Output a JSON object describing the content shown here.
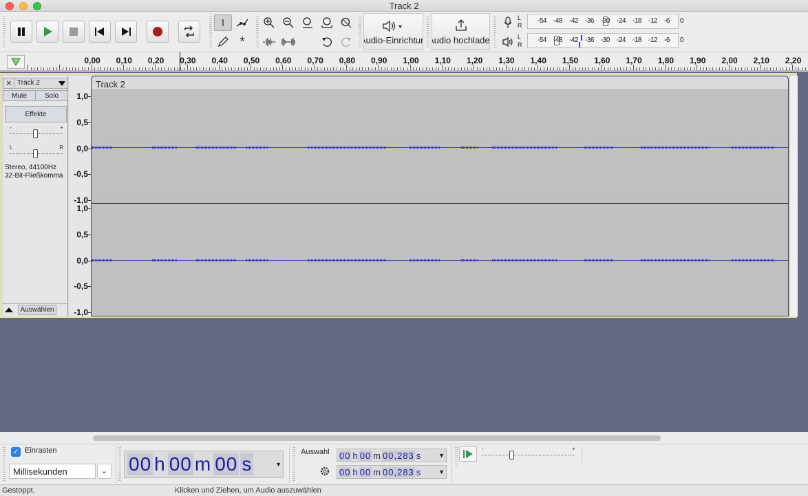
{
  "window": {
    "title": "Track 2"
  },
  "toolbar": {
    "device_button_label": "Audio-Einrichtung",
    "share_button_label": "Audio hochladen",
    "meter_labels": {
      "left": "L",
      "right": "R"
    },
    "record_meter_ticks": [
      "-54",
      "-48",
      "-42",
      "-36",
      "-30",
      "-24",
      "-18",
      "-12",
      "-6",
      "0"
    ],
    "play_meter_ticks": [
      "-54",
      "-48",
      "-42",
      "-36",
      "-30",
      "-24",
      "-18",
      "-12",
      "-6",
      "0"
    ]
  },
  "ruler": {
    "labels": [
      "0,00",
      "0,10",
      "0,20",
      "0,30",
      "0,40",
      "0,50",
      "0,60",
      "0,70",
      "0,80",
      "0,90",
      "1,00",
      "1,10",
      "1,20",
      "1,30",
      "1,40",
      "1,50",
      "1,60",
      "1,70",
      "1,80",
      "1,90",
      "2,00",
      "2,10",
      "2,20"
    ]
  },
  "track": {
    "name": "Track 2",
    "mute_label": "Mute",
    "solo_label": "Solo",
    "effects_label": "Effekte",
    "gain_minus": "-",
    "gain_plus": "+",
    "pan_left": "L",
    "pan_right": "R",
    "format_rate": "Stereo, 44100Hz",
    "format_bits": "32-Bit-Fließkomma",
    "select_label": "Auswählen",
    "clip_title": "Track 2",
    "amplitude_labels": [
      "1,0",
      "0,5",
      "0,0",
      "-0,5",
      "-1,0"
    ]
  },
  "selection": {
    "snap_label": "Einrasten",
    "snap_checked": true,
    "snap_unit": "Millisekunden",
    "audio_position": {
      "h": "00",
      "h_unit": "h",
      "m": "00",
      "m_unit": "m",
      "s": "00",
      "s_unit": "s"
    },
    "selection_label": "Auswahl",
    "start": {
      "h": "00",
      "m": "00",
      "s": "00,283",
      "h_unit": "h",
      "m_unit": "m",
      "s_unit": "s"
    },
    "end": {
      "h": "00",
      "m": "00",
      "s": "00,283",
      "h_unit": "h",
      "m_unit": "m",
      "s_unit": "s"
    },
    "play_speed": {
      "minus": "-",
      "plus": "+"
    }
  },
  "status": {
    "state": "Gestoppt.",
    "hint": "Klicken und Ziehen, um Audio auszuwählen"
  },
  "colors": {
    "track_background": "#646783",
    "waveform": "#2b2dc0",
    "clip": "#c0c0c0",
    "time_digits": "#1c1ca4",
    "record_button": "#a41c1c",
    "play_button": "#2e9b4c"
  }
}
